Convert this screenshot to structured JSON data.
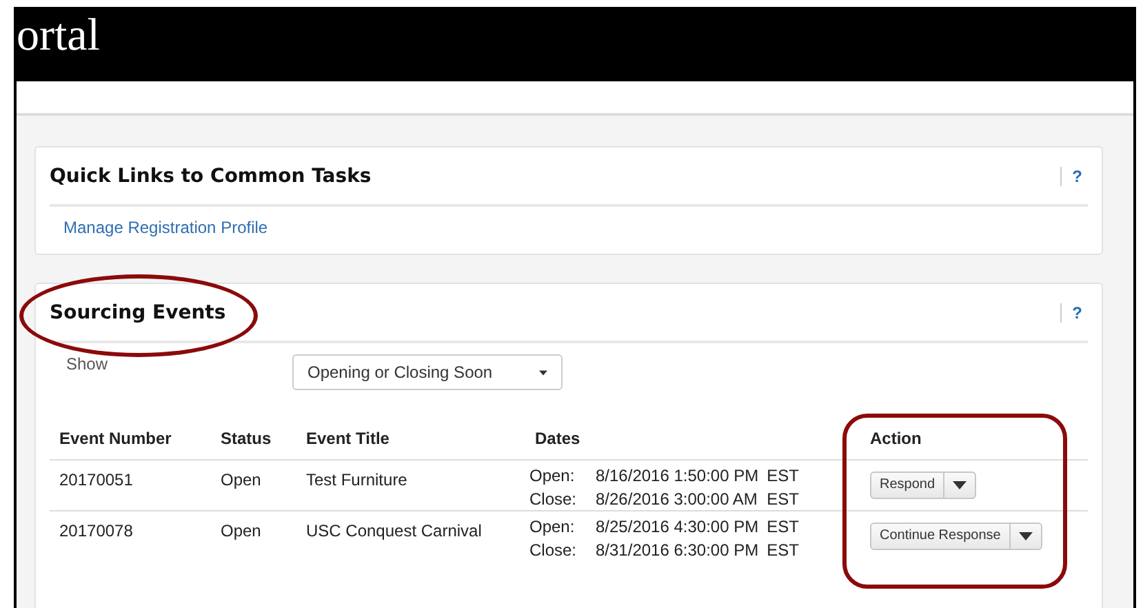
{
  "header": {
    "title": "ortal"
  },
  "quick_links": {
    "title": "Quick Links to Common Tasks",
    "help": "?",
    "links": [
      "Manage Registration Profile"
    ]
  },
  "sourcing_events": {
    "title": "Sourcing Events",
    "help": "?",
    "filter": {
      "label": "Show",
      "value": "Opening or Closing Soon"
    },
    "table": {
      "columns": [
        "Event Number",
        "Status",
        "Event Title",
        "Dates",
        "Action"
      ],
      "rows": [
        {
          "event_number": "20170051",
          "status": "Open",
          "event_title": "Test Furniture",
          "dates": [
            {
              "label": "Open:",
              "value": "8/16/2016 1:50:00 PM",
              "tz": "EST"
            },
            {
              "label": "Close:",
              "value": "8/26/2016 3:00:00 AM",
              "tz": "EST"
            }
          ],
          "action": "Respond"
        },
        {
          "event_number": "20170078",
          "status": "Open",
          "event_title": "USC Conquest Carnival",
          "dates": [
            {
              "label": "Open:",
              "value": "8/25/2016 4:30:00 PM",
              "tz": "EST"
            },
            {
              "label": "Close:",
              "value": "8/31/2016 6:30:00 PM",
              "tz": "EST"
            }
          ],
          "action": "Continue Response"
        }
      ]
    }
  }
}
